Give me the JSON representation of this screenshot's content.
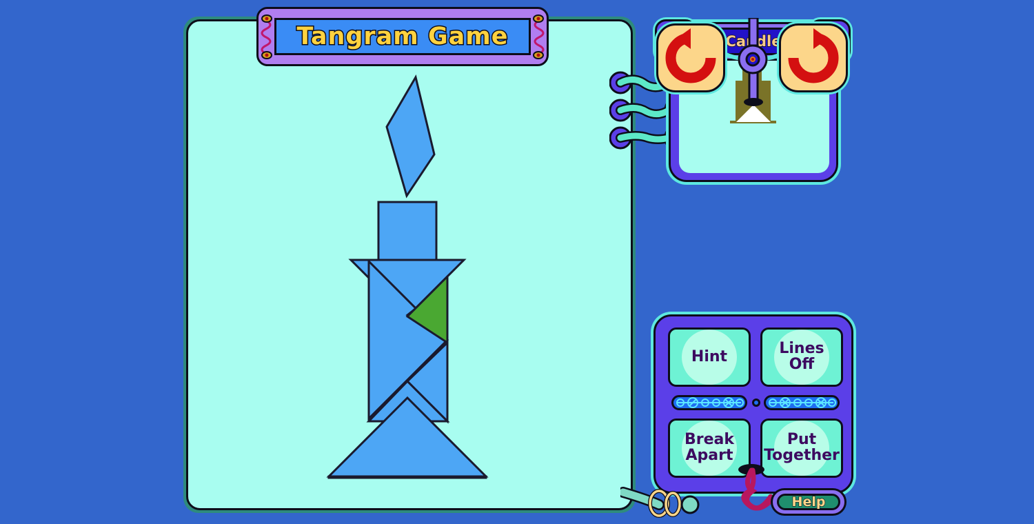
{
  "app": {
    "title": "Tangram Game",
    "background_color": "#3366cc"
  },
  "board": {
    "name": "tangram-play-area",
    "background_color": "#a8fdf0",
    "piece_fill": "#4da6f5",
    "piece_accent_fill": "#4aa832",
    "piece_stroke": "#1a1a2e"
  },
  "puzzle": {
    "name": "Candle",
    "silhouette_color": "#7a7328",
    "preview_background": "#a8fdf0"
  },
  "selector": {
    "current_label": "Candle",
    "prev_icon": "left-arrow-icon",
    "next_icon": "right-arrow-icon"
  },
  "rotate": {
    "counter_clockwise_icon": "rotate-left-icon",
    "clockwise_icon": "rotate-right-icon",
    "icon_color": "#d41010",
    "button_color": "#fcd68a"
  },
  "actions": [
    {
      "id": "hint",
      "label": "Hint"
    },
    {
      "id": "lines",
      "label": "Lines\nOff"
    },
    {
      "id": "break",
      "label": "Break\nApart"
    },
    {
      "id": "put",
      "label": "Put\nTogether"
    }
  ],
  "help": {
    "label": "Help"
  }
}
